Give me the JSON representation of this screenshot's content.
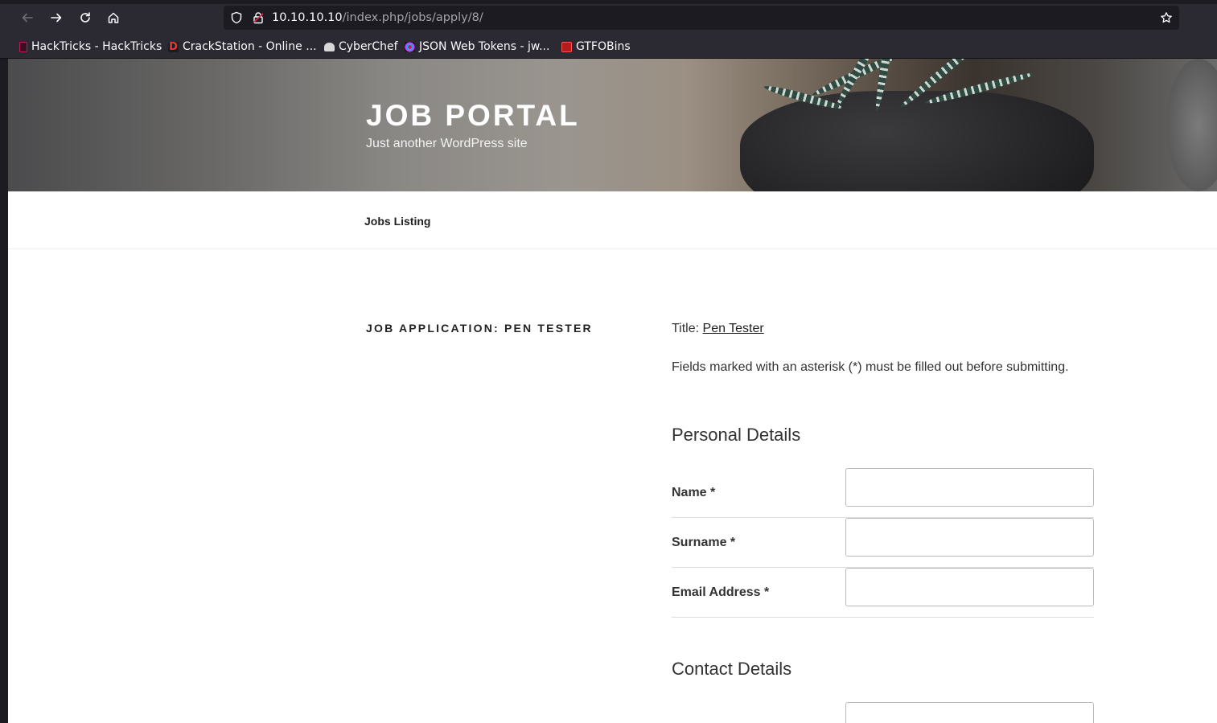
{
  "browser": {
    "url_host": "10.10.10.10",
    "url_path": "/index.php/jobs/apply/8/",
    "bookmarks": [
      {
        "label": "HackTricks - HackTricks",
        "icon": "hacktricks-icon",
        "color": "#c2185b"
      },
      {
        "label": "CrackStation - Online ...",
        "icon": "crackstation-icon",
        "color": "#d32f2f"
      },
      {
        "label": "CyberChef",
        "icon": "cyberchef-icon",
        "color": "#e0e0e0"
      },
      {
        "label": "JSON Web Tokens - jw...",
        "icon": "jwt-icon",
        "color": "#fb015b"
      },
      {
        "label": "GTFOBins",
        "icon": "gtfobins-icon",
        "color": "#b71c1c"
      }
    ]
  },
  "site": {
    "title": "JOB PORTAL",
    "description": "Just another WordPress site"
  },
  "nav": {
    "jobs_listing": "Jobs Listing"
  },
  "application": {
    "heading": "JOB APPLICATION: PEN TESTER",
    "title_prefix": "Title:",
    "title_link": "Pen Tester",
    "notice": "Fields marked with an asterisk (*) must be filled out before submitting.",
    "personal_heading": "Personal Details",
    "fields": [
      {
        "label": "Name *",
        "value": ""
      },
      {
        "label": "Surname *",
        "value": ""
      },
      {
        "label": "Email Address *",
        "value": ""
      }
    ],
    "contact_heading": "Contact Details"
  }
}
